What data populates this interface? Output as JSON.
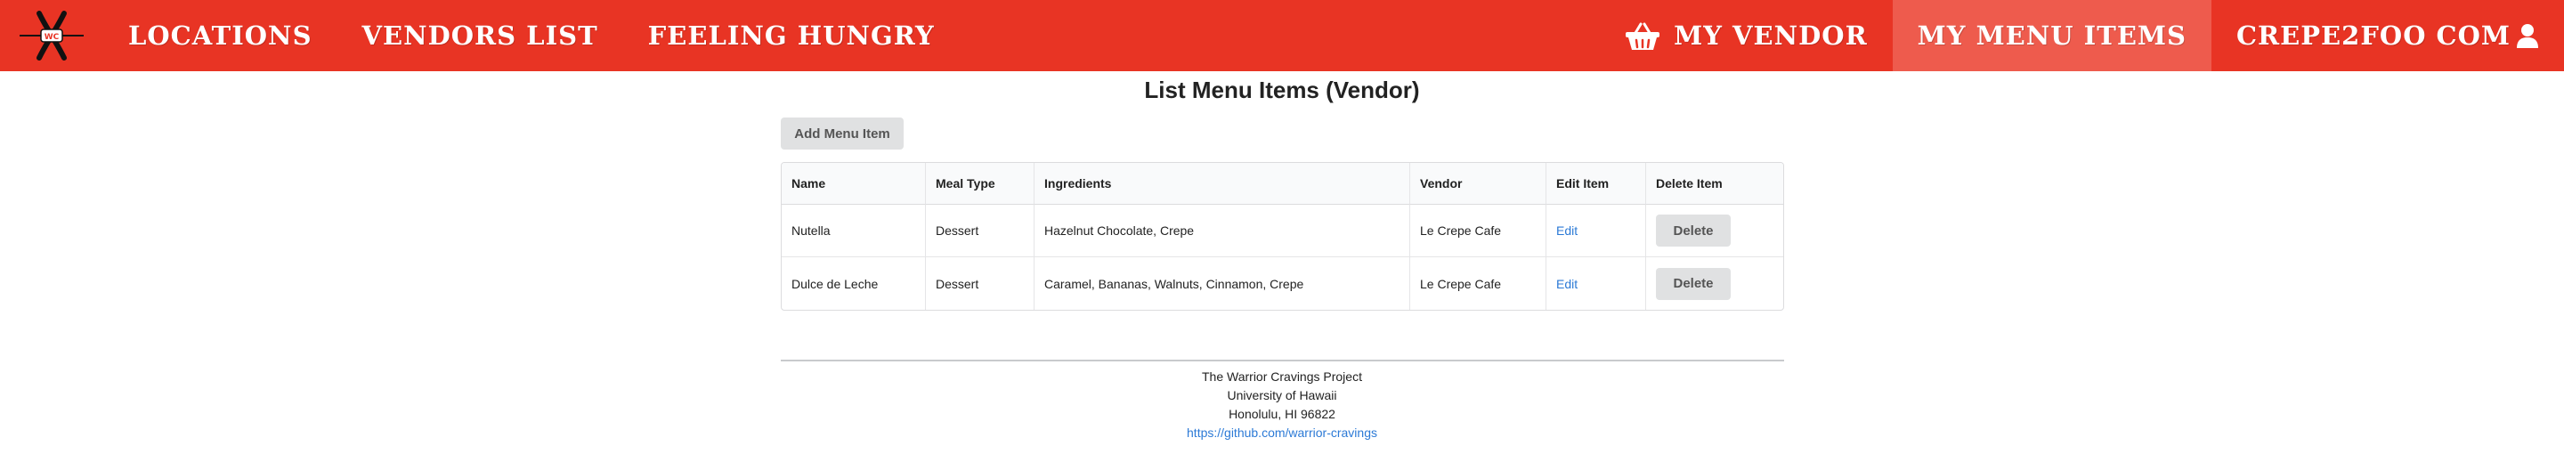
{
  "navbar": {
    "logo_text": "WC",
    "items": [
      {
        "label": "LOCATIONS"
      },
      {
        "label": "VENDORS LIST"
      },
      {
        "label": "FEELING HUNGRY"
      }
    ],
    "my_vendor": "MY VENDOR",
    "my_menu_items": "MY MENU ITEMS",
    "user": "CREPE2FOO COM",
    "colors": {
      "bar": "#e83424",
      "active": "#ee5b4d"
    }
  },
  "page": {
    "title": "List Menu Items (Vendor)",
    "add_button": "Add Menu Item"
  },
  "table": {
    "headers": [
      "Name",
      "Meal Type",
      "Ingredients",
      "Vendor",
      "Edit Item",
      "Delete Item"
    ],
    "rows": [
      {
        "name": "Nutella",
        "meal_type": "Dessert",
        "ingredients": "Hazelnut Chocolate, Crepe",
        "vendor": "Le Crepe Cafe",
        "edit": "Edit",
        "delete": "Delete"
      },
      {
        "name": "Dulce de Leche",
        "meal_type": "Dessert",
        "ingredients": "Caramel, Bananas, Walnuts, Cinnamon, Crepe",
        "vendor": "Le Crepe Cafe",
        "edit": "Edit",
        "delete": "Delete"
      }
    ]
  },
  "footer": {
    "line1": "The Warrior Cravings Project",
    "line2": "University of Hawaii",
    "line3": "Honolulu, HI 96822",
    "link": "https://github.com/warrior-cravings"
  }
}
